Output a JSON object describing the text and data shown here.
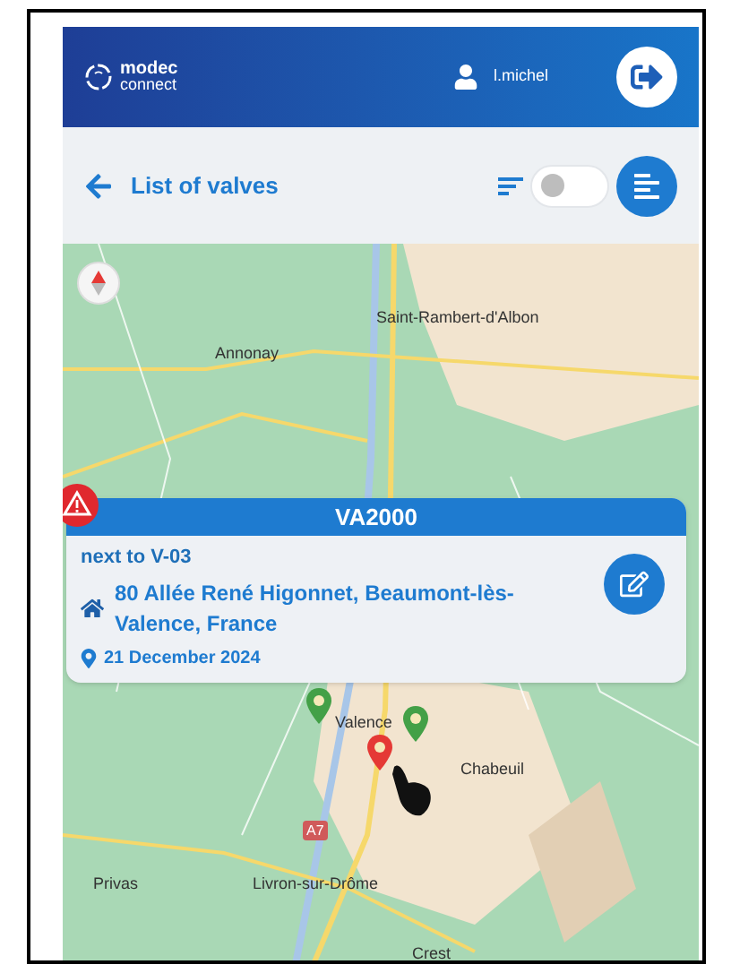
{
  "header": {
    "logo": {
      "name": "modec",
      "tagline": "connect"
    },
    "user": "l.michel"
  },
  "toolbar": {
    "title": "List of valves",
    "toggle": {
      "on": false
    }
  },
  "map": {
    "labels": [
      {
        "text": "Saint-Rambert-d'Albon",
        "kind": "town"
      },
      {
        "text": "Annonay",
        "kind": "town"
      },
      {
        "text": "Valence",
        "kind": "town"
      },
      {
        "text": "Chabeuil",
        "kind": "town"
      },
      {
        "text": "A7",
        "kind": "road"
      },
      {
        "text": "Privas",
        "kind": "town"
      },
      {
        "text": "Livron-sur-Drôme",
        "kind": "town"
      },
      {
        "text": "Crest",
        "kind": "town"
      }
    ],
    "markers": [
      {
        "color": "#43a047"
      },
      {
        "color": "#43a047"
      },
      {
        "color": "#e53935"
      }
    ]
  },
  "card": {
    "title": "VA2000",
    "alert": true,
    "subtitle": "next to V-03",
    "address": "80 Allée René Higonnet, Beaumont-lès-Valence, France",
    "date": "21 December 2024"
  }
}
